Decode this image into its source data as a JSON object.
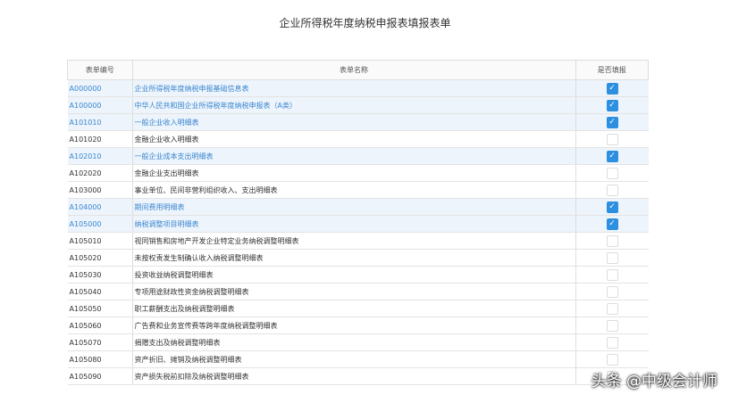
{
  "title": "企业所得税年度纳税申报表填报表单",
  "headers": {
    "code": "表单编号",
    "name": "表单名称",
    "fill": "是否填报"
  },
  "rows": [
    {
      "code": "A000000",
      "name": "企业所得税年度纳税申报基础信息表",
      "checked": true
    },
    {
      "code": "A100000",
      "name": "中华人民共和国企业所得税年度纳税申报表（A类）",
      "checked": true
    },
    {
      "code": "A101010",
      "name": "一般企业收入明细表",
      "checked": true
    },
    {
      "code": "A101020",
      "name": "金融企业收入明细表",
      "checked": false
    },
    {
      "code": "A102010",
      "name": "一般企业成本支出明细表",
      "checked": true
    },
    {
      "code": "A102020",
      "name": "金融企业支出明细表",
      "checked": false
    },
    {
      "code": "A103000",
      "name": "事业单位、民间非营利组织收入、支出明细表",
      "checked": false
    },
    {
      "code": "A104000",
      "name": "期间费用明细表",
      "checked": true
    },
    {
      "code": "A105000",
      "name": "纳税调整项目明细表",
      "checked": true
    },
    {
      "code": "A105010",
      "name": "视同销售和房地产开发企业特定业务纳税调整明细表",
      "checked": false
    },
    {
      "code": "A105020",
      "name": "未按权责发生制确认收入纳税调整明细表",
      "checked": false
    },
    {
      "code": "A105030",
      "name": "投资收益纳税调整明细表",
      "checked": false
    },
    {
      "code": "A105040",
      "name": "专项用途财政性资金纳税调整明细表",
      "checked": false
    },
    {
      "code": "A105050",
      "name": "职工薪酬支出及纳税调整明细表",
      "checked": false
    },
    {
      "code": "A105060",
      "name": "广告费和业务宣传费等跨年度纳税调整明细表",
      "checked": false
    },
    {
      "code": "A105070",
      "name": "捐赠支出及纳税调整明细表",
      "checked": false
    },
    {
      "code": "A105080",
      "name": "资产折旧、摊销及纳税调整明细表",
      "checked": false
    },
    {
      "code": "A105090",
      "name": "资产损失税前扣除及纳税调整明细表",
      "checked": false
    }
  ],
  "watermark": "头条 @中级会计师"
}
